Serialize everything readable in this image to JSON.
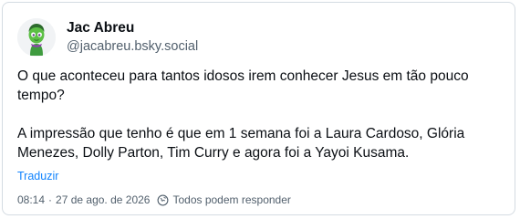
{
  "author": {
    "display_name": "Jac Abreu",
    "handle": "@jacabreu.bsky.social",
    "avatar_icon": "green-character-avatar"
  },
  "post": {
    "paragraphs": [
      "O que aconteceu para tantos idosos irem conhecer Jesus em tão pouco tempo?",
      "A impressão que tenho é que em 1 semana foi a Laura Cardoso, Glória Menezes, Dolly Parton, Tim Curry e agora foi a Yayoi Kusama."
    ],
    "translate_label": "Traduzir"
  },
  "meta": {
    "time": "08:14",
    "separator": "·",
    "date": "27 de ago. de 2026",
    "reply_permission": "Todos podem responder",
    "reply_icon": "globe-reply-icon"
  },
  "colors": {
    "link": "#1083fe",
    "muted": "#52606d",
    "border": "#d4dbe2"
  }
}
